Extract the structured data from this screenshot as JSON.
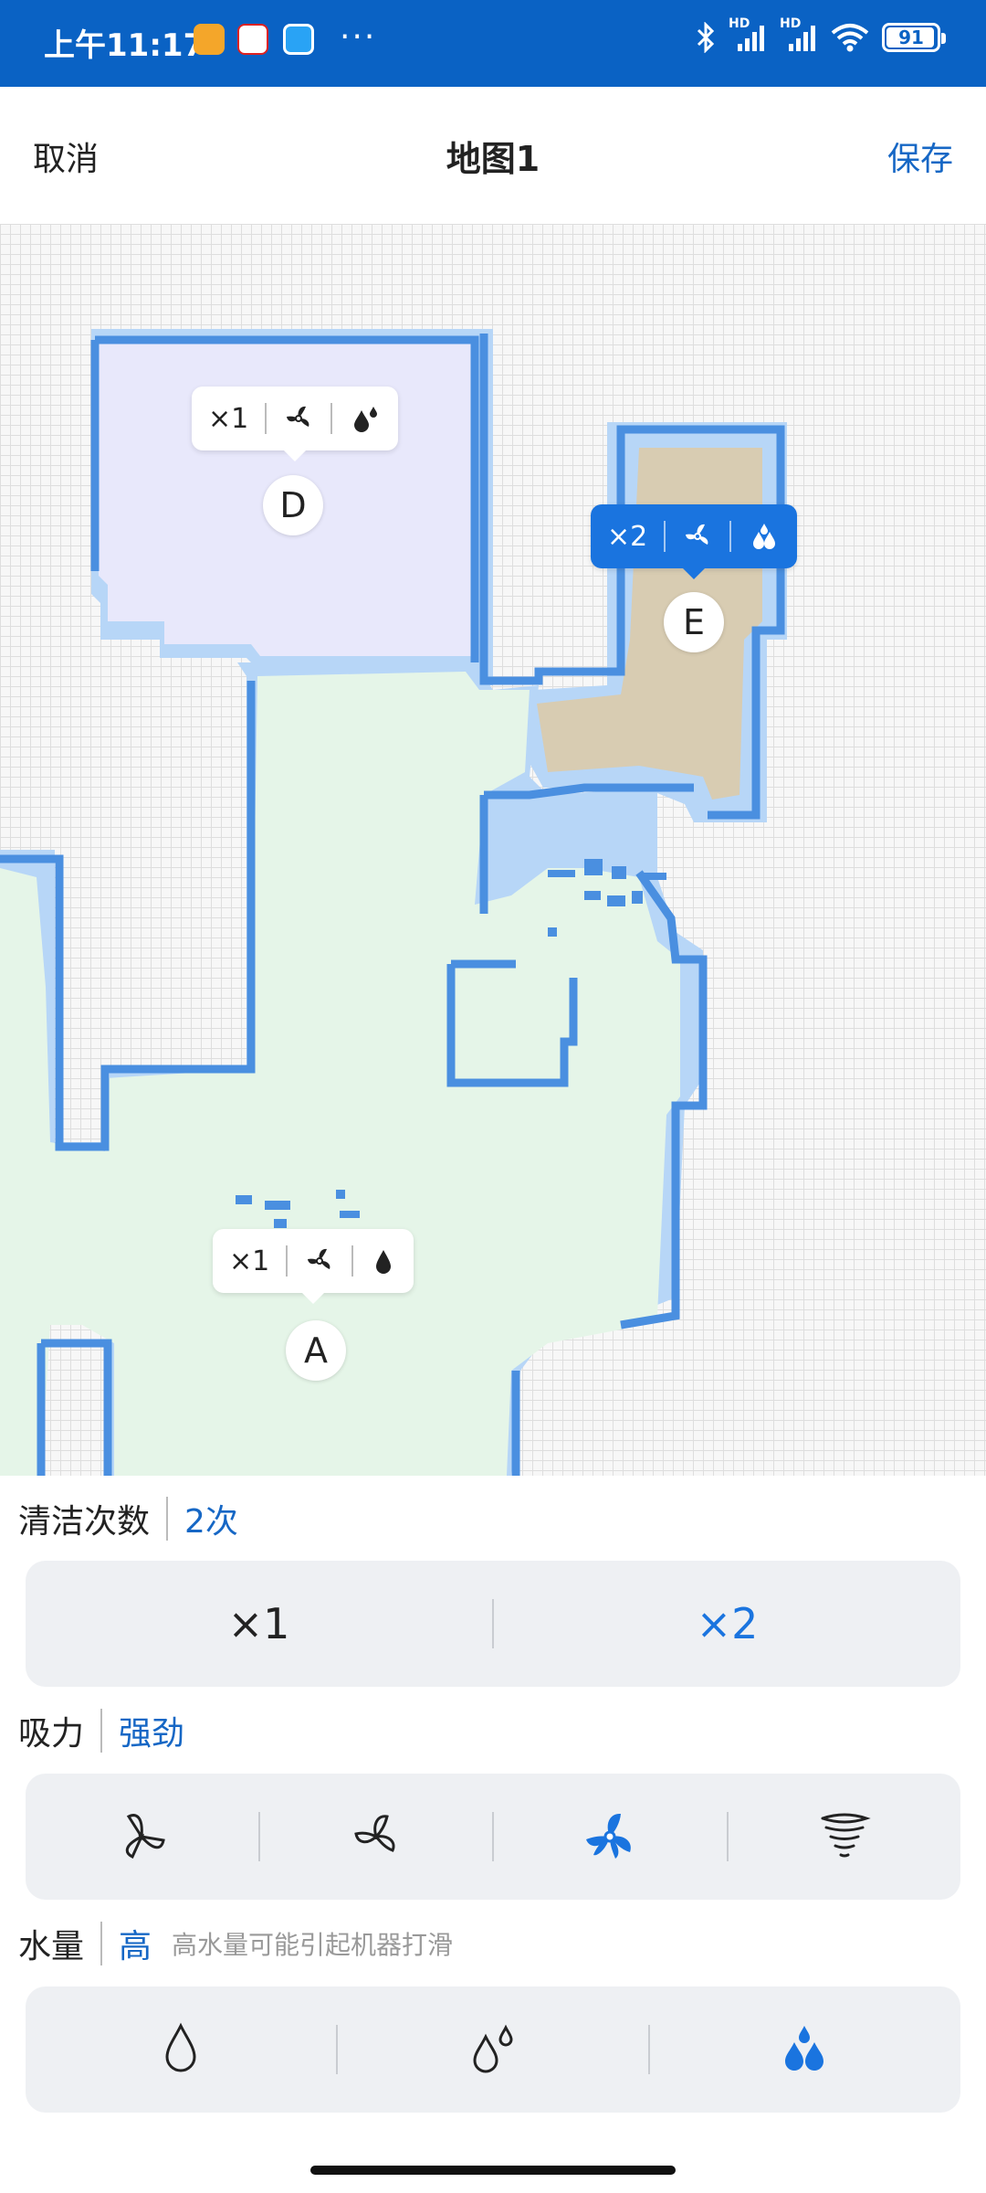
{
  "status_bar": {
    "time": "上午11:17",
    "more": "···",
    "battery": "91",
    "network": [
      "HD",
      "HD"
    ]
  },
  "header": {
    "cancel": "取消",
    "title": "地图1",
    "save": "保存"
  },
  "map": {
    "rooms": [
      {
        "label": "D",
        "times": "×1",
        "suction": "fan-icon",
        "water": "water-drop-medium-icon",
        "selected": false
      },
      {
        "label": "E",
        "times": "×2",
        "suction": "fan-icon",
        "water": "water-drop-high-icon",
        "selected": true
      },
      {
        "label": "A",
        "times": "×1",
        "suction": "fan-icon",
        "water": "water-drop-low-icon",
        "selected": false
      }
    ]
  },
  "settings": {
    "clean_times": {
      "label": "清洁次数",
      "value": "2次",
      "options": [
        "×1",
        "×2"
      ],
      "selected": 1
    },
    "suction": {
      "label": "吸力",
      "value": "强劲",
      "options": [
        "quiet-fan-icon",
        "standard-fan-icon",
        "strong-fan-icon",
        "max-tornado-icon"
      ],
      "selected": 2
    },
    "water": {
      "label": "水量",
      "value": "高",
      "hint": "高水量可能引起机器打滑",
      "options": [
        "water-drop-low-icon",
        "water-drop-medium-icon",
        "water-drop-high-icon"
      ],
      "selected": 2
    }
  },
  "colors": {
    "status_bar": "#0a62c4",
    "accent": "#1a74df",
    "room_d": "#e8e8fb",
    "room_e": "#d8ccb2",
    "room_a": "#e5f5e8",
    "wall": "#4a8fe0",
    "wall_halo": "#b7d6f7"
  }
}
